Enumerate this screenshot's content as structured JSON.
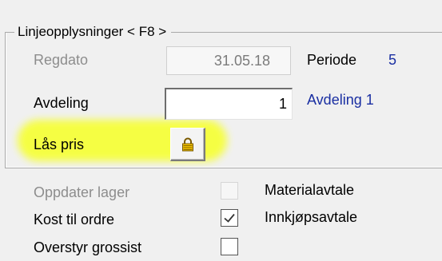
{
  "group": {
    "title": "Linjeopplysninger  < F8 >"
  },
  "regdato": {
    "label": "Regdato",
    "value": "31.05.18"
  },
  "periode": {
    "label": "Periode",
    "value": "5"
  },
  "avdeling": {
    "label": "Avdeling",
    "value": "1",
    "name": "Avdeling 1"
  },
  "las_pris": {
    "label": "Lås pris",
    "icon": "lock-icon",
    "highlight_color": "#f6ff3a"
  },
  "checkboxes": [
    {
      "label": "Oppdater lager",
      "checked": false,
      "enabled": false
    },
    {
      "label": "Kost til ordre",
      "checked": true,
      "enabled": true
    },
    {
      "label": "Overstyr grossist",
      "checked": false,
      "enabled": true
    }
  ],
  "options": [
    {
      "label": "Materialavtale"
    },
    {
      "label": "Innkjøpsavtale"
    }
  ],
  "colors": {
    "link_blue": "#1a2fa2",
    "disabled_text": "#8d8d8d",
    "form_background": "#f0f0f0"
  }
}
